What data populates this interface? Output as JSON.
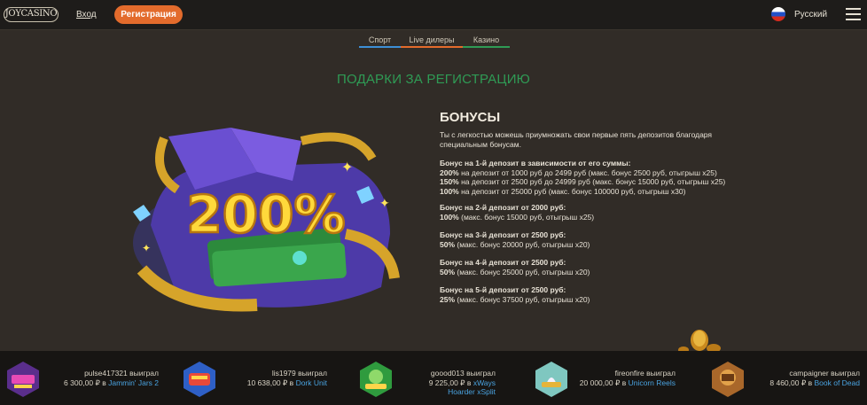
{
  "header": {
    "logo": "JOYCASINO",
    "login": "Вход",
    "register": "Регистрация",
    "language": "Русский"
  },
  "nav": {
    "tabs": [
      {
        "label": "Спорт",
        "color": "#3d8fd6"
      },
      {
        "label": "Live дилеры",
        "color": "#e36b2c"
      },
      {
        "label": "Казино",
        "color": "#2f9b55"
      }
    ]
  },
  "main": {
    "title": "ПОДАРКИ ЗА РЕГИСТРАЦИЮ",
    "promo_art_text": "200%",
    "bonus_title": "БОНУСЫ",
    "intro": "Ты с легкостью можешь приумножать свои первые пять депозитов благодаря специальным бонусам.",
    "deposit1": {
      "heading": "Бонус на 1-й депозит в зависимости от его суммы:",
      "lines": [
        {
          "pct": "200%",
          "rest": " на депозит от 1000 руб до 2499 руб (макс. бонус 2500 руб, отыгрыш x25)"
        },
        {
          "pct": "150%",
          "rest": " на депозит от 2500 руб до 24999 руб (макс. бонус 15000 руб, отыгрыш x25)"
        },
        {
          "pct": "100%",
          "rest": " на депозит от 25000 руб (макс. бонус 100000 руб, отыгрыш x30)"
        }
      ]
    },
    "deposit2": {
      "heading": "Бонус на 2-й депозит от 2000 руб:",
      "pct": "100%",
      "rest": " (макс. бонус 15000 руб, отыгрыш x25)"
    },
    "deposit3": {
      "heading": "Бонус на 3-й депозит от 2500 руб:",
      "pct": "50%",
      "rest": " (макс. бонус 20000 руб, отыгрыш x20)"
    },
    "deposit4": {
      "heading": "Бонус на 4-й депозит от 2500 руб:",
      "pct": "50%",
      "rest": " (макс. бонус 25000 руб, отыгрыш x20)"
    },
    "deposit5": {
      "heading": "Бонус на 5-й депозит от 2500 руб:",
      "pct": "25%",
      "rest": " (макс. бонус 37500 руб, отыгрыш x20)"
    }
  },
  "winners": [
    {
      "user": "pulse417321 выиграл",
      "amount": "6 300,00 ₽ в ",
      "game": "Jammin' Jars 2",
      "icon": "jammin-jars-icon"
    },
    {
      "user": "lis1979 выиграл",
      "amount": "10 638,00 ₽ в ",
      "game": "Dork Unit",
      "icon": "dork-unit-icon"
    },
    {
      "user": "goood013 выиграл",
      "amount": "9 225,00 ₽ в ",
      "game": "xWays Hoarder xSplit",
      "icon": "xways-hoarder-icon"
    },
    {
      "user": "fireonfire выиграл",
      "amount": "20 000,00 ₽ в ",
      "game": "Unicorn Reels",
      "icon": "unicorn-reels-icon"
    },
    {
      "user": "campaigner выиграл",
      "amount": "8 460,00 ₽ в ",
      "game": "Book of Dead",
      "icon": "book-of-dead-icon"
    }
  ]
}
